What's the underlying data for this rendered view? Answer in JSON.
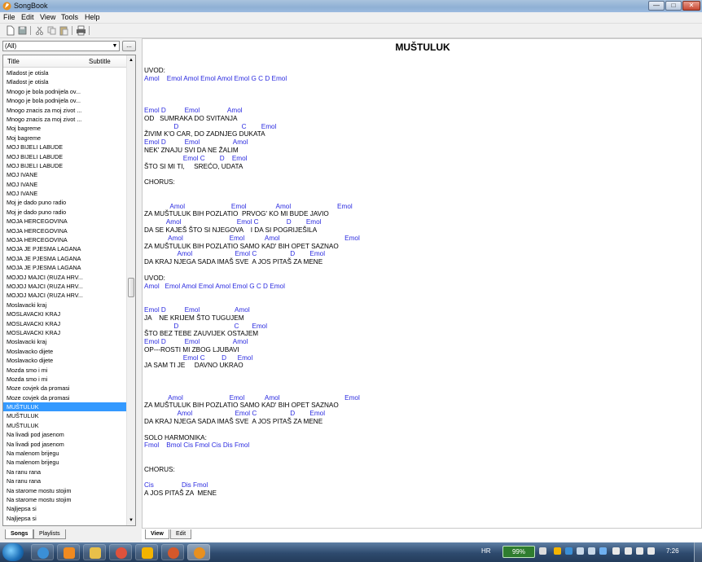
{
  "window": {
    "title": "SongBook",
    "minimize": "—",
    "maximize": "□",
    "close": "✕"
  },
  "menu": [
    "File",
    "Edit",
    "View",
    "Tools",
    "Help"
  ],
  "filter": {
    "value": "(All)",
    "more": "..."
  },
  "list": {
    "columns": {
      "title": "Title",
      "subtitle": "Subtitle"
    },
    "selected_index": 36,
    "items": [
      "Mladost je otisla",
      "Mladost je otisla",
      "Mnogo je bola podnijela ov...",
      "Mnogo je bola podnijela ov...",
      "Mnogo znacis za moj zivot ...",
      "Mnogo znacis za moj zivot ...",
      "Moj bagreme",
      "Moj bagreme",
      "MOJ BIJELI LABUDE",
      "MOJ BIJELI LABUDE",
      "MOJ BIJELI LABUDE",
      "MOJ IVANE",
      "MOJ IVANE",
      "MOJ IVANE",
      "Moj je dado puno radio",
      "Moj je dado puno radio",
      "MOJA HERCEGOVINA",
      "MOJA HERCEGOVINA",
      "MOJA HERCEGOVINA",
      "MOJA JE PJESMA LAGANA",
      "MOJA JE PJESMA LAGANA",
      "MOJA JE PJESMA LAGANA",
      "MOJOJ MAJCI (RUZA HRV...",
      "MOJOJ MAJCI (RUZA HRV...",
      "MOJOJ MAJCI (RUZA HRV...",
      "Moslavacki kraj",
      "MOSLAVACKI KRAJ",
      "MOSLAVACKI KRAJ",
      "MOSLAVACKI KRAJ",
      "Moslavacki kraj",
      "Moslavacko dijete",
      "Moslavacko dijete",
      "Mozda smo i mi",
      "Mozda smo i mi",
      "Moze covjek da promasi",
      "Moze covjek da promasi",
      "MUŠTULUK",
      "MUŠTULUK",
      "MUŠTULUK",
      "Na livadi pod jasenom",
      "Na livadi pod jasenom",
      "Na malenom brijegu",
      "Na malenom brijegu",
      "Na ranu rana",
      "Na ranu rana",
      "Na starome mostu stojim",
      "Na starome mostu stojim",
      "Najljepsa si",
      "Najljepsa si"
    ]
  },
  "left_tabs": [
    "Songs",
    "Playlists"
  ],
  "right_tabs": [
    "View",
    "Edit"
  ],
  "song": {
    "title": "MUŠTULUK",
    "lines": [
      {
        "t": "l",
        "s": "UVOD:"
      },
      {
        "t": "c",
        "s": "Amol    Emol Amol Emol Amol Emol G C D Emol"
      },
      {
        "t": "b",
        "s": ""
      },
      {
        "t": "b",
        "s": ""
      },
      {
        "t": "b",
        "s": ""
      },
      {
        "t": "c",
        "s": "Emol D          Emol               Amol"
      },
      {
        "t": "l",
        "s": "OD   SUMRAKA DO SVITANJA"
      },
      {
        "t": "c",
        "s": "                D                                  C        Emol"
      },
      {
        "t": "l",
        "s": "ŽIVIM K'O CAR, DO ZADNJEG DUKATA"
      },
      {
        "t": "c",
        "s": "Emol D          Emol                  Amol"
      },
      {
        "t": "l",
        "s": "NEK' ZNAJU SVI DA NE ŽALIM"
      },
      {
        "t": "c",
        "s": "                     Emol C        D    Emol"
      },
      {
        "t": "l",
        "s": "ŠTO SI MI TI,     SREĆO, UDATA"
      },
      {
        "t": "b",
        "s": ""
      },
      {
        "t": "l",
        "s": "CHORUS:"
      },
      {
        "t": "b",
        "s": ""
      },
      {
        "t": "b",
        "s": ""
      },
      {
        "t": "c",
        "s": "              Amol                         Emol                Amol                         Emol"
      },
      {
        "t": "l",
        "s": "ZA MUŠTULUK BIH POZLATIO  PRVOG' KO MI BUDE JAVIO"
      },
      {
        "t": "c",
        "s": "            Amol                              Emol C               D        Emol"
      },
      {
        "t": "l",
        "s": "DA SE KAJEŠ ŠTO SI NJEGOVA    I DA SI POGRIJEŠILA"
      },
      {
        "t": "c",
        "s": "             Amol                         Emol           Amol                                   Emol"
      },
      {
        "t": "l",
        "s": "ZA MUŠTULUK BIH POZLATIO SAMO KAD' BIH OPET SAZNAO"
      },
      {
        "t": "c",
        "s": "                  Amol                       Emol C                  D        Emol"
      },
      {
        "t": "l",
        "s": "DA KRAJ NJEGA SADA IMAŠ SVE  A JOS PITAŠ ZA MENE"
      },
      {
        "t": "b",
        "s": ""
      },
      {
        "t": "l",
        "s": "UVOD:"
      },
      {
        "t": "c",
        "s": "Amol   Emol Amol Emol Amol Emol G C D Emol"
      },
      {
        "t": "b",
        "s": ""
      },
      {
        "t": "b",
        "s": ""
      },
      {
        "t": "c",
        "s": "Emol D          Emol                   Amol"
      },
      {
        "t": "l",
        "s": "JA    NE KRIJEM ŠTO TUGUJEM"
      },
      {
        "t": "c",
        "s": "                D                              C       Emol"
      },
      {
        "t": "l",
        "s": "ŠTO BEZ TEBE ZAUVIJEK OSTAJEM"
      },
      {
        "t": "c",
        "s": "Emol D          Emol                  Amol"
      },
      {
        "t": "l",
        "s": "OP---ROSTI MI ZBOG LJUBAVI"
      },
      {
        "t": "c",
        "s": "                     Emol C         D      Emol"
      },
      {
        "t": "l",
        "s": "JA SAM TI JE     DAVNO UKRAO"
      },
      {
        "t": "b",
        "s": ""
      },
      {
        "t": "b",
        "s": ""
      },
      {
        "t": "b",
        "s": ""
      },
      {
        "t": "c",
        "s": "             Amol                         Emol           Amol                                   Emol"
      },
      {
        "t": "l",
        "s": "ZA MUŠTULUK BIH POZLATIO SAMO KAD' BIH OPET SAZNAO"
      },
      {
        "t": "c",
        "s": "                  Amol                       Emol C                  D        Emol"
      },
      {
        "t": "l",
        "s": "DA KRAJ NJEGA SADA IMAŠ SVE  A JOS PITAŠ ZA MENE"
      },
      {
        "t": "b",
        "s": ""
      },
      {
        "t": "l",
        "s": "SOLO HARMONIKA:"
      },
      {
        "t": "c",
        "s": "Fmol    Bmol Cis Fmol Cis Dis Fmol"
      },
      {
        "t": "b",
        "s": ""
      },
      {
        "t": "b",
        "s": ""
      },
      {
        "t": "l",
        "s": "CHORUS:"
      },
      {
        "t": "b",
        "s": ""
      },
      {
        "t": "c",
        "s": "Cis               Dis Fmol"
      },
      {
        "t": "l",
        "s": "A JOS PITAŠ ZA  MENE"
      }
    ]
  },
  "taskbar": {
    "lang": "HR",
    "battery": "99%",
    "time": "7:26"
  },
  "colors": {
    "chord": "#2b2be0",
    "selection": "#3399ff"
  },
  "icons": [
    "new-icon",
    "save-icon",
    "cut-icon",
    "copy-icon",
    "paste-icon",
    "print-icon"
  ]
}
